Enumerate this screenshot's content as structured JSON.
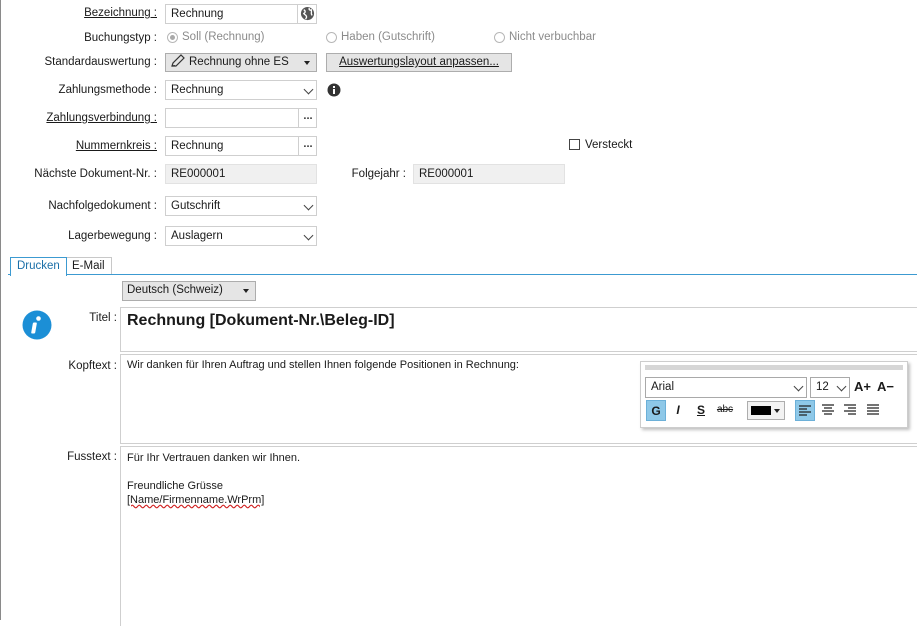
{
  "form": {
    "bezeichnung": {
      "label": "Bezeichnung :",
      "value": "Rechnung"
    },
    "buchungstyp": {
      "label": "Buchungstyp :",
      "options": [
        "Soll (Rechnung)",
        "Haben (Gutschrift)",
        "Nicht verbuchbar"
      ],
      "selected": "Soll (Rechnung)"
    },
    "standardauswertung": {
      "label": "Standardauswertung :",
      "value": "Rechnung ohne ES",
      "layout_button": "Auswertungslayout anpassen..."
    },
    "zahlungsmethode": {
      "label": "Zahlungsmethode :",
      "value": "Rechnung"
    },
    "zahlungsverbindung": {
      "label": "Zahlungsverbindung :",
      "value": ""
    },
    "nummernkreis": {
      "label": "Nummernkreis :",
      "value": "Rechnung",
      "versteckt_label": "Versteckt",
      "versteckt_checked": false
    },
    "naechste_dokument_nr": {
      "label": "Nächste Dokument-Nr. :",
      "value": "RE000001"
    },
    "folgejahr": {
      "label": "Folgejahr :",
      "value": "RE000001"
    },
    "nachfolgedokument": {
      "label": "Nachfolgedokument :",
      "value": "Gutschrift"
    },
    "lagerbewegung": {
      "label": "Lagerbewegung :",
      "value": "Auslagern"
    }
  },
  "tabs": [
    {
      "label": "Drucken",
      "active": true
    },
    {
      "label": "E-Mail",
      "active": false
    }
  ],
  "print": {
    "language": "Deutsch (Schweiz)",
    "titel_label": "Titel :",
    "titel_value": "Rechnung [Dokument-Nr.\\Beleg-ID]",
    "kopftext_label": "Kopftext :",
    "kopftext_value": "Wir danken für Ihren Auftrag und stellen Ihnen folgende Positionen in Rechnung:",
    "fusstext_label": "Fusstext :",
    "fusstext_lines": [
      "Für Ihr Vertrauen danken wir Ihnen.",
      "",
      "Freundliche Grüsse",
      "[Name/Firmenname.WrPrm]"
    ]
  },
  "format_toolbar": {
    "font": "Arial",
    "size": "12",
    "grow_label": "A+",
    "shrink_label": "A−",
    "bold": "G",
    "italic": "I",
    "underline": "S",
    "strike": "abc",
    "text_color": "#000000"
  },
  "colors": {
    "accent": "#3c9ad1",
    "info_icon": "#1c8fd6"
  }
}
